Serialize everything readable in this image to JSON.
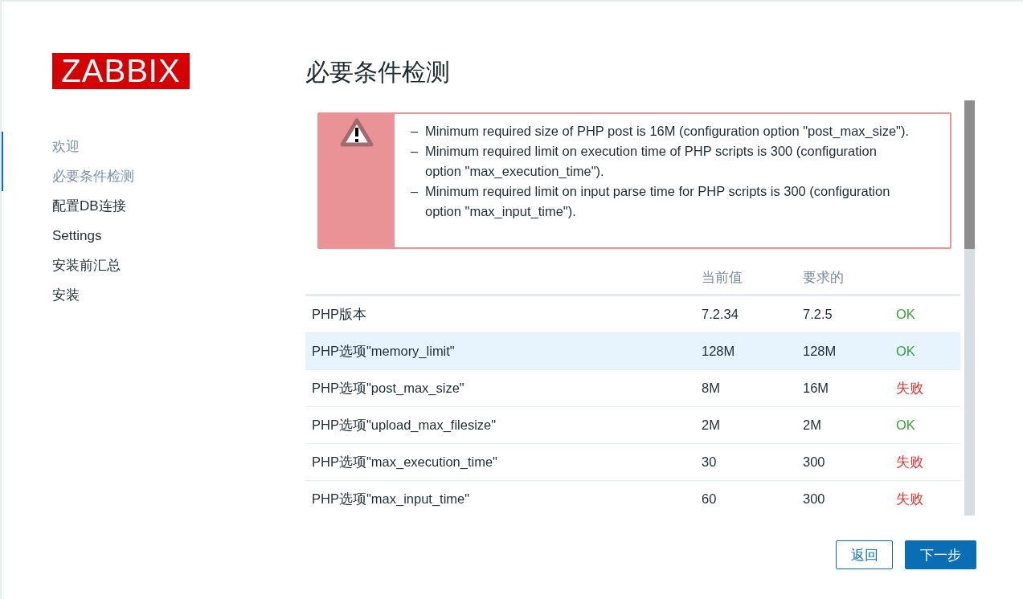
{
  "logo": "ZABBIX",
  "steps": [
    {
      "label": "欢迎",
      "visited": true
    },
    {
      "label": "必要条件检测",
      "visited": true
    },
    {
      "label": "配置DB连接",
      "visited": false
    },
    {
      "label": "Settings",
      "visited": false
    },
    {
      "label": "安装前汇总",
      "visited": false
    },
    {
      "label": "安装",
      "visited": false
    }
  ],
  "title": "必要条件检测",
  "alert": {
    "messages": [
      "Minimum required size of PHP post is 16M (configuration option \"post_max_size\").",
      "Minimum required limit on execution time of PHP scripts is 300 (configuration option \"max_execution_time\").",
      "Minimum required limit on input parse time for PHP scripts is 300 (configuration option \"max_input_time\")."
    ],
    "bullet": "–"
  },
  "table": {
    "columns": [
      "当前值",
      "要求的"
    ],
    "rows": [
      {
        "name": "PHP版本",
        "current": "7.2.34",
        "required": "7.2.5",
        "status": "OK",
        "passed": true,
        "highlighted": false
      },
      {
        "name": "PHP选项\"memory_limit\"",
        "current": "128M",
        "required": "128M",
        "status": "OK",
        "passed": true,
        "highlighted": true
      },
      {
        "name": "PHP选项\"post_max_size\"",
        "current": "8M",
        "required": "16M",
        "status": "失败",
        "passed": false,
        "highlighted": false
      },
      {
        "name": "PHP选项\"upload_max_filesize\"",
        "current": "2M",
        "required": "2M",
        "status": "OK",
        "passed": true,
        "highlighted": false
      },
      {
        "name": "PHP选项\"max_execution_time\"",
        "current": "30",
        "required": "300",
        "status": "失败",
        "passed": false,
        "highlighted": false
      },
      {
        "name": "PHP选项\"max_input_time\"",
        "current": "60",
        "required": "300",
        "status": "失败",
        "passed": false,
        "highlighted": false
      }
    ]
  },
  "buttons": {
    "back": "返回",
    "next": "下一步"
  }
}
